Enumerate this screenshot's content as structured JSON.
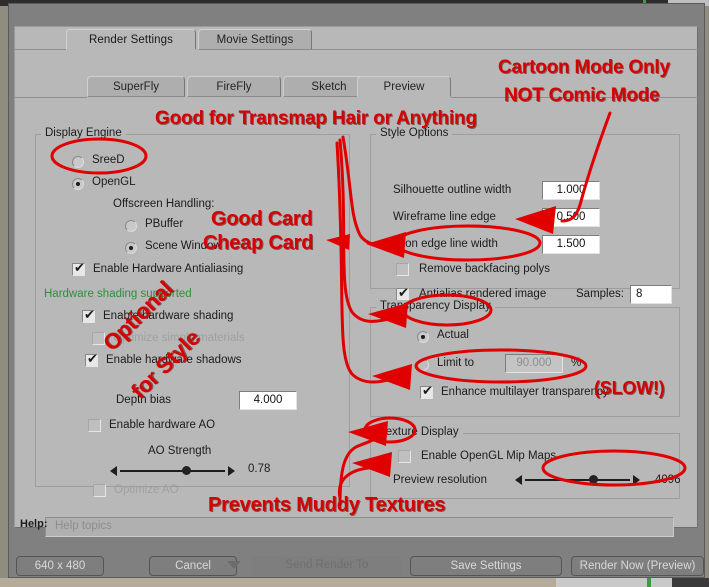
{
  "window": {
    "title": "Render Settings"
  },
  "tabs": [
    {
      "label": "Render Settings",
      "active": true
    },
    {
      "label": "Movie Settings",
      "active": false
    }
  ],
  "subtabs": [
    {
      "label": "SuperFly",
      "active": false
    },
    {
      "label": "FireFly",
      "active": false
    },
    {
      "label": "Sketch",
      "active": false
    },
    {
      "label": "Preview",
      "active": true
    }
  ],
  "display_engine": {
    "title": "Display Engine",
    "engines": [
      {
        "label": "SreeD",
        "selected": false
      },
      {
        "label": "OpenGL",
        "selected": true
      }
    ],
    "offscreen_title": "Offscreen Handling:",
    "offscreen": [
      {
        "label": "PBuffer",
        "selected": false
      },
      {
        "label": "Scene Window",
        "selected": true
      }
    ],
    "enable_hw_antialiasing": {
      "label": "Enable Hardware Antialiasing",
      "checked": true
    },
    "hw_shading_status": "Hardware shading supported",
    "enable_hw_shading": {
      "label": "Enable hardware shading",
      "checked": true
    },
    "optimize_simple_materials": {
      "label": "Optimize simple materials",
      "checked": false,
      "disabled": true
    },
    "enable_hw_shadows": {
      "label": "Enable hardware shadows",
      "checked": true
    },
    "depth_bias": {
      "label": "Depth bias",
      "value": "4.000"
    },
    "enable_hw_ao": {
      "label": "Enable hardware AO",
      "checked": false
    },
    "ao_strength": {
      "label": "AO Strength",
      "value": "0.78",
      "knob_pct": 62
    },
    "optimize_ao": {
      "label": "Optimize AO",
      "checked": false,
      "disabled": true
    }
  },
  "style_options": {
    "title": "Style Options",
    "rows": [
      {
        "label": "Silhouette outline width",
        "value": "1.000"
      },
      {
        "label": "Wireframe line edge",
        "value": "0.500"
      },
      {
        "label": "Toon edge line width",
        "value": "1.500"
      }
    ],
    "remove_backfacing": {
      "label": "Remove backfacing polys",
      "checked": false
    },
    "antialias_rendered": {
      "label": "Antialias rendered image",
      "checked": true
    },
    "samples": {
      "label": "Samples:",
      "value": "8"
    }
  },
  "transparency_display": {
    "title": "Transparency Display",
    "actual": {
      "label": "Actual",
      "selected": true
    },
    "limit_to": {
      "label": "Limit to",
      "selected": false,
      "value": "90.000",
      "unit": "%"
    },
    "enhance_multilayer": {
      "label": "Enhance multilayer transparency",
      "checked": true
    }
  },
  "texture_display": {
    "title": "Texture Display",
    "mip_maps": {
      "label": "Enable OpenGL Mip Maps",
      "checked": false
    },
    "preview_resolution": {
      "label": "Preview resolution",
      "value": "4096",
      "knob_pct": 63
    }
  },
  "help": {
    "label": "Help:",
    "placeholder": "Help topics"
  },
  "footer": {
    "resolution_button": "640 x 480",
    "cancel_button": "Cancel",
    "send_render_to": "Send Render To",
    "save_settings": "Save Settings",
    "render_now": "Render Now (Preview)"
  },
  "annotations": [
    {
      "id": "transmap",
      "text": "Good for Transmap Hair or Anything"
    },
    {
      "id": "cartoon1",
      "text": "Cartoon Mode Only"
    },
    {
      "id": "cartoon2",
      "text": "NOT Comic Mode"
    },
    {
      "id": "goodcard",
      "text": "Good Card"
    },
    {
      "id": "cheapcard",
      "text": "Cheap Card"
    },
    {
      "id": "optional",
      "text": "Optional"
    },
    {
      "id": "forstyle",
      "text": "for Style"
    },
    {
      "id": "slow",
      "text": "(SLOW!)"
    },
    {
      "id": "muddy",
      "text": "Prevents Muddy Textures"
    }
  ],
  "colors": {
    "annotation_red": "#d60000",
    "dialog_face": "#b8b8b8",
    "status_green": "#2f8f3a"
  }
}
